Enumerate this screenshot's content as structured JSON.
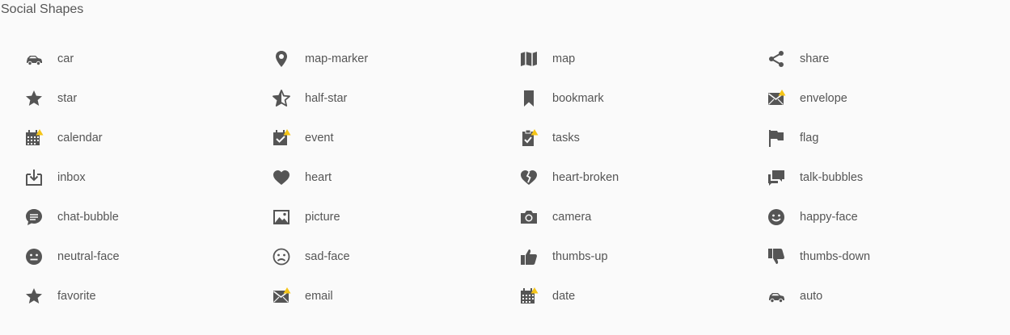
{
  "section": {
    "title": "Social Shapes"
  },
  "colors": {
    "icon": "#555555",
    "warning_badge": "#f5c518",
    "background": "#fafafa"
  },
  "icons": [
    {
      "label": "car",
      "icon": "car-icon",
      "warning": false
    },
    {
      "label": "map-marker",
      "icon": "map-marker-icon",
      "warning": false
    },
    {
      "label": "map",
      "icon": "map-icon",
      "warning": false
    },
    {
      "label": "share",
      "icon": "share-icon",
      "warning": false
    },
    {
      "label": "star",
      "icon": "star-icon",
      "warning": false
    },
    {
      "label": "half-star",
      "icon": "half-star-icon",
      "warning": false
    },
    {
      "label": "bookmark",
      "icon": "bookmark-icon",
      "warning": false
    },
    {
      "label": "envelope",
      "icon": "envelope-icon",
      "warning": true
    },
    {
      "label": "calendar",
      "icon": "calendar-icon",
      "warning": true
    },
    {
      "label": "event",
      "icon": "event-icon",
      "warning": true
    },
    {
      "label": "tasks",
      "icon": "tasks-icon",
      "warning": true
    },
    {
      "label": "flag",
      "icon": "flag-icon",
      "warning": false
    },
    {
      "label": "inbox",
      "icon": "inbox-icon",
      "warning": false
    },
    {
      "label": "heart",
      "icon": "heart-icon",
      "warning": false
    },
    {
      "label": "heart-broken",
      "icon": "heart-broken-icon",
      "warning": false
    },
    {
      "label": "talk-bubbles",
      "icon": "talk-bubbles-icon",
      "warning": false
    },
    {
      "label": "chat-bubble",
      "icon": "chat-bubble-icon",
      "warning": false
    },
    {
      "label": "picture",
      "icon": "picture-icon",
      "warning": false
    },
    {
      "label": "camera",
      "icon": "camera-icon",
      "warning": false
    },
    {
      "label": "happy-face",
      "icon": "happy-face-icon",
      "warning": false
    },
    {
      "label": "neutral-face",
      "icon": "neutral-face-icon",
      "warning": false
    },
    {
      "label": "sad-face",
      "icon": "sad-face-icon",
      "warning": false
    },
    {
      "label": "thumbs-up",
      "icon": "thumbs-up-icon",
      "warning": false
    },
    {
      "label": "thumbs-down",
      "icon": "thumbs-down-icon",
      "warning": false
    },
    {
      "label": "favorite",
      "icon": "favorite-icon",
      "warning": false
    },
    {
      "label": "email",
      "icon": "email-icon",
      "warning": true
    },
    {
      "label": "date",
      "icon": "date-icon",
      "warning": true
    },
    {
      "label": "auto",
      "icon": "auto-icon",
      "warning": false
    }
  ]
}
